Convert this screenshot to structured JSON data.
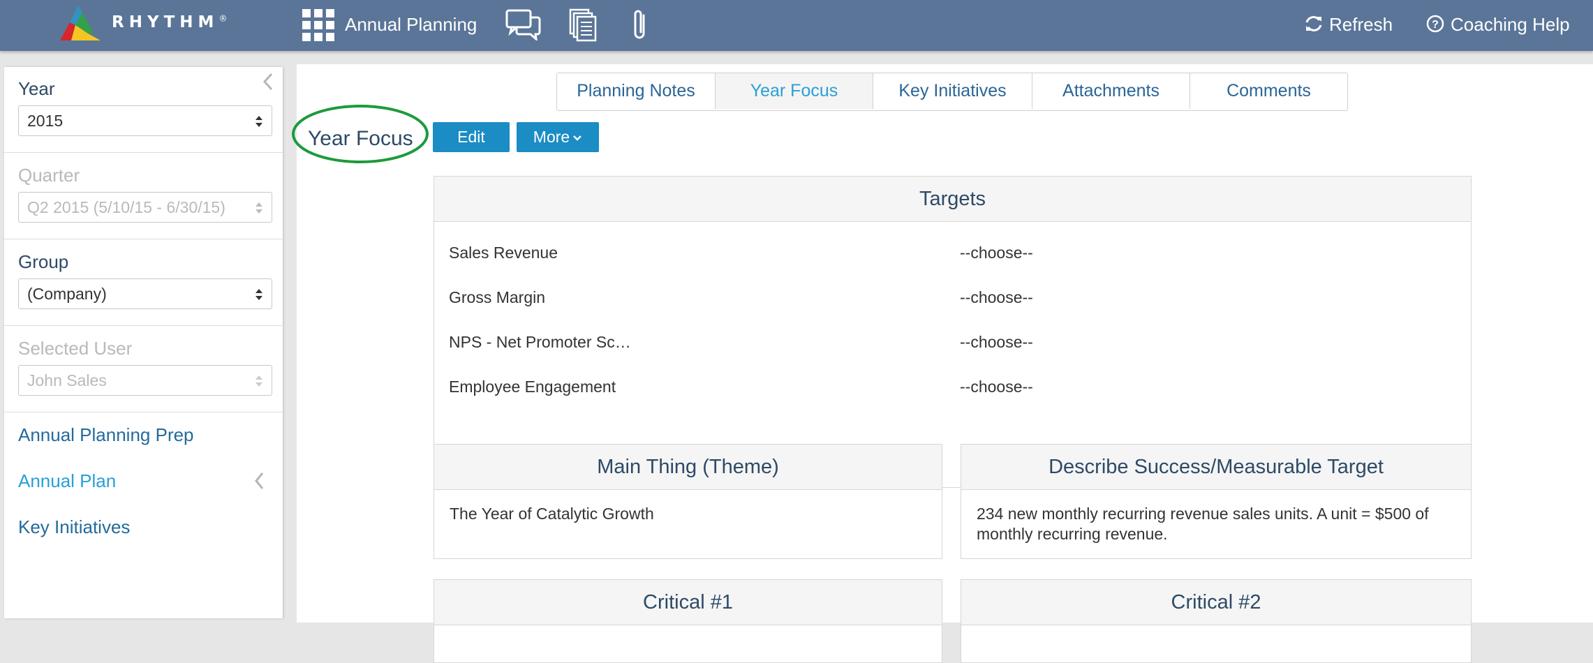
{
  "app": {
    "brand": "RHYTHM",
    "brand_mark": "®",
    "nav_title": "Annual Planning",
    "refresh": "Refresh",
    "coaching_help": "Coaching Help"
  },
  "sidebar": {
    "year_label": "Year",
    "year_value": "2015",
    "quarter_label": "Quarter",
    "quarter_value": "Q2 2015 (5/10/15 - 6/30/15)",
    "group_label": "Group",
    "group_value": "(Company)",
    "user_label": "Selected User",
    "user_value": "John Sales",
    "links": [
      "Annual Planning Prep",
      "Annual Plan",
      "Key Initiatives"
    ]
  },
  "tabs": [
    "Planning Notes",
    "Year Focus",
    "Key Initiatives",
    "Attachments",
    "Comments"
  ],
  "active_tab": "Year Focus",
  "section": {
    "title": "Year Focus",
    "edit": "Edit",
    "more": "More"
  },
  "targets": {
    "title": "Targets",
    "rows": [
      {
        "name": "Sales Revenue",
        "value": "--choose--"
      },
      {
        "name": "Gross Margin",
        "value": "--choose--"
      },
      {
        "name": "NPS - Net Promoter Sc…",
        "value": "--choose--"
      },
      {
        "name": "Employee Engagement",
        "value": "--choose--"
      }
    ]
  },
  "main_thing": {
    "title": "Main Thing (Theme)",
    "text": "The Year of Catalytic Growth"
  },
  "success": {
    "title": "Describe Success/Measurable Target",
    "text": "234 new monthly recurring revenue sales units. A unit = $500 of monthly recurring revenue."
  },
  "critical": [
    "Critical #1",
    "Critical #2"
  ],
  "colors": {
    "topbar": "#5a7598",
    "link": "#246a9c",
    "active": "#2a9fd8",
    "button": "#1b8cc4",
    "warning_text": "#e3121b",
    "highlight_circle": "#1d9a3c"
  }
}
